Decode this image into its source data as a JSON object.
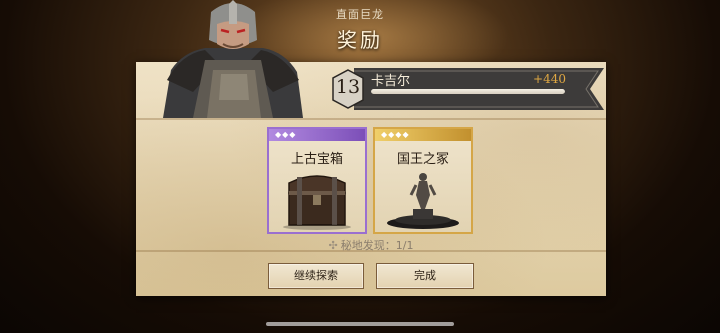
{
  "header": {
    "subtitle": "直面巨龙",
    "title": "奖励"
  },
  "hero": {
    "level": "13",
    "name": "卡吉尔",
    "xp_gain": "+440",
    "xp_progress": 1.0
  },
  "rewards": [
    {
      "name": "上古宝箱",
      "rarity": "epic",
      "rarity_gems": "◆◆◆",
      "icon": "treasure-chest-icon",
      "rarity_color": "#9a6fd0"
    },
    {
      "name": "国王之冢",
      "rarity": "legendary",
      "rarity_gems": "◆◆◆◆",
      "icon": "king-statue-icon",
      "rarity_color": "#d5a647"
    }
  ],
  "secret_found": {
    "icon": "compass-star-icon",
    "label": "秘地发现：1/1"
  },
  "buttons": {
    "continue_label": "继续探索",
    "done_label": "完成"
  }
}
